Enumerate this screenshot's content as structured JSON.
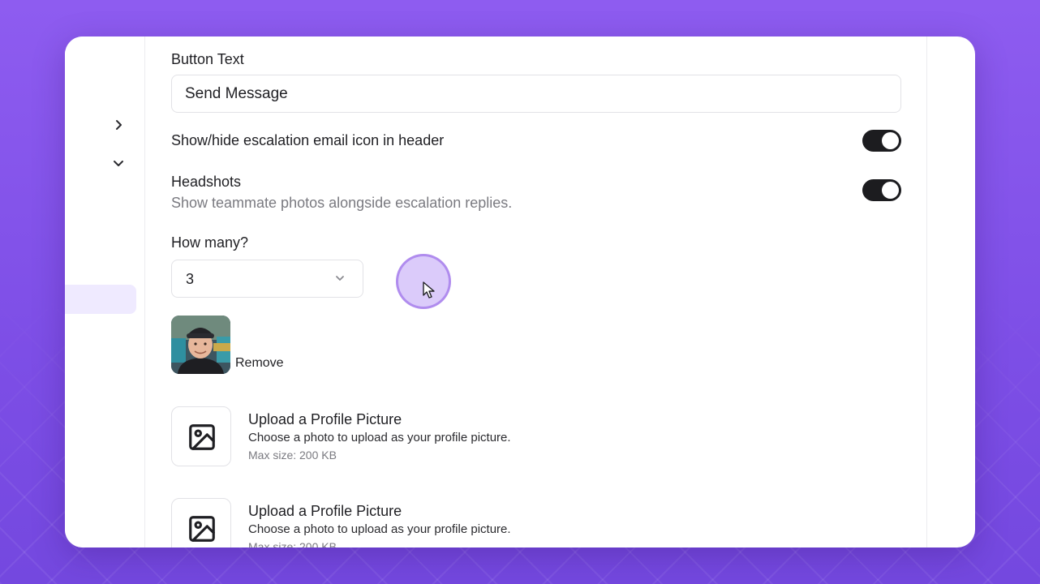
{
  "form": {
    "button_text_label": "Button Text",
    "button_text_value": "Send Message",
    "escalation_icon_label": "Show/hide escalation email icon in header",
    "escalation_icon_enabled": true,
    "headshots_label": "Headshots",
    "headshots_description": "Show teammate photos alongside escalation replies.",
    "headshots_enabled": true,
    "how_many_label": "How many?",
    "how_many_value": "3",
    "remove_label": "Remove",
    "uploads": [
      {
        "title": "Upload a Profile Picture",
        "description": "Choose a photo to upload as your profile picture.",
        "max_size": "Max size: 200 KB"
      },
      {
        "title": "Upload a Profile Picture",
        "description": "Choose a photo to upload as your profile picture.",
        "max_size": "Max size: 200 KB"
      }
    ]
  },
  "sidebar": {
    "icons": [
      "chevron-right-icon",
      "chevron-down-icon"
    ]
  },
  "colors": {
    "background": "#8e5cf0",
    "toggle_on": "#1c1c1f",
    "sidebar_selected": "#efeaff",
    "cursor_highlight": "#bea0f5"
  }
}
